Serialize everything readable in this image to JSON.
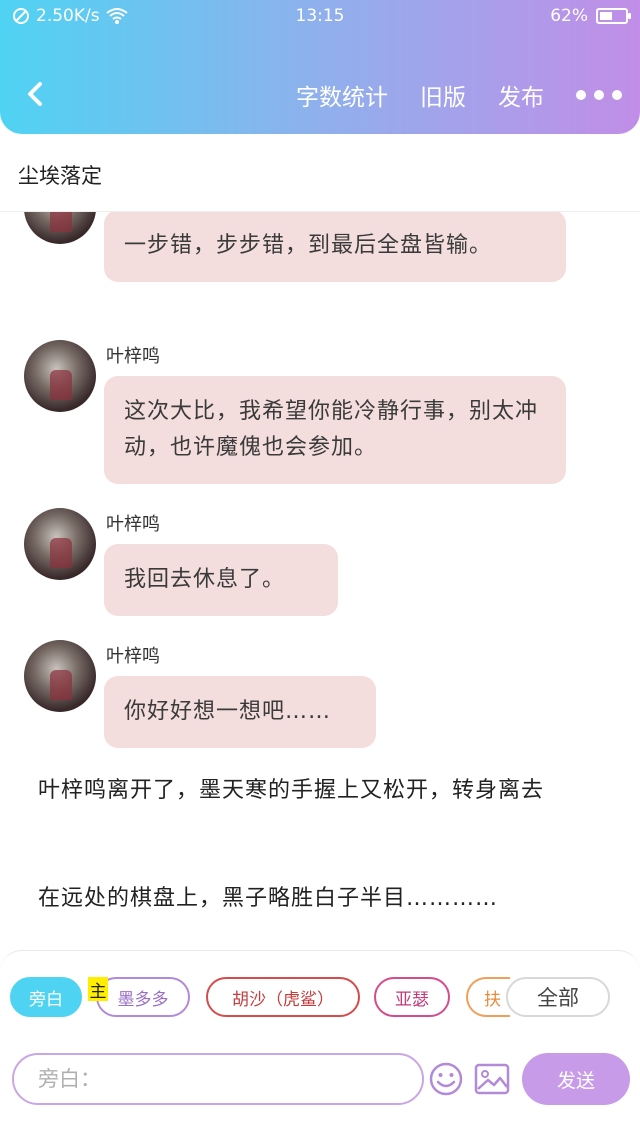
{
  "status": {
    "speed": "2.50K/s",
    "time": "13:15",
    "battery": "62%"
  },
  "nav": {
    "word_count": "字数统计",
    "old_version": "旧版",
    "publish": "发布"
  },
  "story_title": "尘埃落定",
  "messages": [
    {
      "text": "一步错，步步错，到最后全盘皆输。"
    },
    {
      "name": "叶梓鸣",
      "text": "这次大比，我希望你能冷静行事，别太冲动，也许魔傀也会参加。"
    },
    {
      "name": "叶梓鸣",
      "text": "我回去休息了。"
    },
    {
      "name": "叶梓鸣",
      "text": "你好好想一想吧……"
    }
  ],
  "narration": [
    "叶梓鸣离开了，墨天寒的手握上又松开，转身离去",
    "在远处的棋盘上，黑子略胜白子半目…………"
  ],
  "chips": {
    "narrator": "旁白",
    "main_mark": "主",
    "c1": "墨多多",
    "c2": "胡沙（虎鲨）",
    "c3": "亚瑟",
    "c4": "扶",
    "all": "全部"
  },
  "input": {
    "placeholder": "旁白：",
    "send": "发送"
  },
  "colors": {
    "header_start": "#4fd3f3",
    "header_end": "#c18ee8",
    "bubble": "#f3dddd",
    "send": "#c79be8"
  }
}
